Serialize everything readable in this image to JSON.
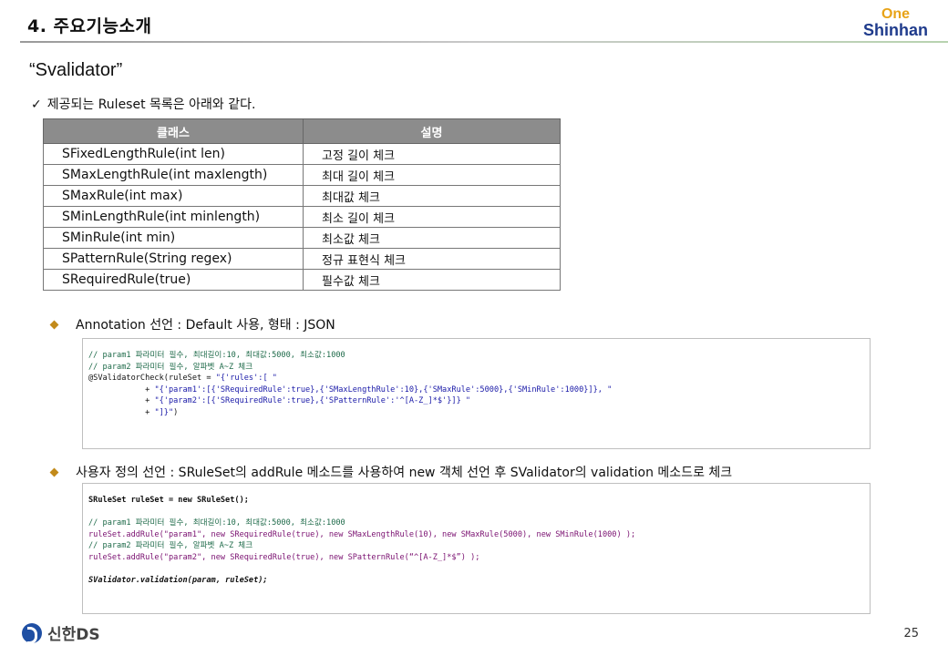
{
  "header": {
    "title": "4. 주요기능소개",
    "logo_top": "One",
    "logo_bottom": "Shinhan"
  },
  "page_title": "“Svalidator”",
  "checklist": {
    "mark": "✓",
    "text": "제공되는 Ruleset 목록은 아래와 같다."
  },
  "table": {
    "headers": [
      "클래스",
      "설명"
    ],
    "rows": [
      [
        "SFixedLengthRule(int len)",
        "고정 길이 체크"
      ],
      [
        "SMaxLengthRule(int maxlength)",
        "최대 길이 체크"
      ],
      [
        "SMaxRule(int max)",
        "최대값 체크"
      ],
      [
        "SMinLengthRule(int minlength)",
        "최소 길이 체크"
      ],
      [
        "SMinRule(int min)",
        "최소값 체크"
      ],
      [
        "SPatternRule(String regex)",
        "정규 표현식 체크"
      ],
      [
        "SRequiredRule(true)",
        "필수값 체크"
      ]
    ]
  },
  "bullet1": "Annotation 선언 : Default 사용,  형태 : JSON",
  "bullet2": "사용자 정의 선언 : SRuleSet의 addRule 메소드를 사용하여 new 객체 선언 후 SValidator의 validation 메소드로 체크",
  "code1": {
    "line1": "// param1 파라미터 필수, 최대길이:10, 최대값:5000, 최소값:1000",
    "line2": "// param2 파라미터 필수, 알파벳 A~Z 체크",
    "line3a": "@SValidatorCheck(ruleSet = ",
    "line3b": "\"{'rules':[ \"",
    "line4a": "            + ",
    "line4b": "\"{'param1':[{'SRequiredRule':true},{'SMaxLengthRule':10},{'SMaxRule':5000},{'SMinRule':1000}]}, \"",
    "line5a": "            + ",
    "line5b": "\"{'param2':[{'SRequiredRule':true},{'SPatternRule':'^[A-Z_]*$'}]} \"",
    "line6a": "            + ",
    "line6b": "\"]}\"",
    "line6c": ")"
  },
  "code2": {
    "line1": "SRuleSet ruleSet = new SRuleSet();",
    "line2": "// param1 파라미터 필수, 최대길이:10, 최대값:5000, 최소값:1000",
    "line3": "ruleSet.addRule(\"param1\", new SRequiredRule(true), new SMaxLengthRule(10), new SMaxRule(5000), new SMinRule(1000) );",
    "line4": "// param2 파라미터 필수, 알파벳 A~Z 체크",
    "line5": "ruleSet.addRule(\"param2\", new SRequiredRule(true), new SPatternRule(“^[A-Z_]*$”) );",
    "line6": "SValidator.validation(param, ruleSet);"
  },
  "footer": {
    "logo_text": "신한DS",
    "page_number": "25"
  }
}
